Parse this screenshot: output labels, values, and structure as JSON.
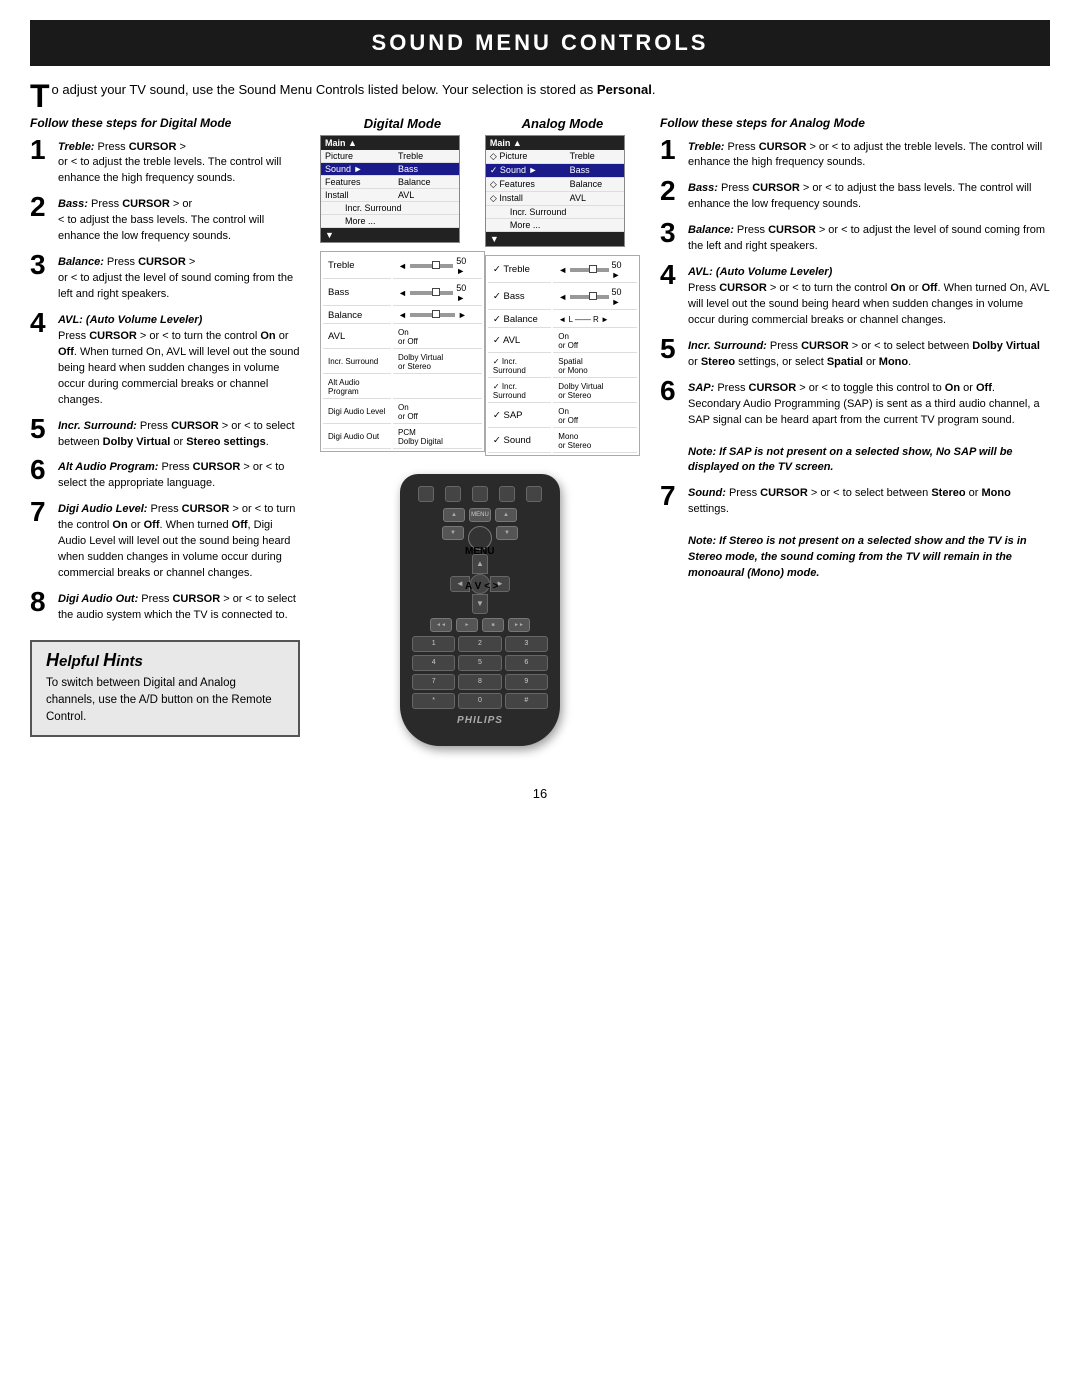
{
  "title": "SOUND MENU CONTROLS",
  "intro": {
    "drop_cap": "T",
    "text": "o adjust your TV sound, use the Sound Menu Controls listed below.  Your selection is stored as ",
    "bold": "Personal",
    "end": "."
  },
  "left": {
    "section_header": "Follow these steps for Digital Mode",
    "steps": [
      {
        "num": "1",
        "label_bold": "Treble:",
        "label_rest": " Press ",
        "cursor": "CURSOR",
        "after_cursor": " >",
        "body": "or < to adjust the treble levels. The control will enhance the high frequency sounds."
      },
      {
        "num": "2",
        "label_bold": "Bass:",
        "label_rest": " Press ",
        "cursor": "CURSOR",
        "after_cursor": " > or",
        "body": "< to adjust the bass levels. The control will enhance the low frequency sounds."
      },
      {
        "num": "3",
        "label_bold": "Balance:",
        "label_rest": " Press ",
        "cursor": "CURSOR",
        "after_cursor": " >",
        "body": "or < to adjust the level of sound coming from the left and right speakers."
      },
      {
        "num": "4",
        "label_bold": "AVL:  (Auto Volume Leveler)",
        "body_before": "Press ",
        "cursor": "CURSOR",
        "after_cursor": " > or <",
        "body": "to turn the control On or Off. When turned On, AVL will level out the sound being heard when sudden changes in volume occur during commercial breaks or channel changes."
      },
      {
        "num": "5",
        "label_bold": "Incr. Surround:",
        "label_rest": " Press",
        "cursor": "CURSOR",
        "after_cursor": " > or <",
        "body": "to select between Dolby Virtual or Stereo settings."
      },
      {
        "num": "6",
        "label_bold": "Alt Audio Program:",
        "label_rest": " Press",
        "cursor": "CURSOR",
        "after_cursor": " > or <",
        "body": "to select the appropriate language."
      },
      {
        "num": "7",
        "label_bold": "Digi Audio Level:",
        "label_rest": " Press",
        "cursor": "CURSOR",
        "after_cursor": " > or <",
        "body": "to turn the control On or Off. When turned Off, Digi Audio Level will level out the sound being heard when sudden changes in volume occur during commercial breaks or channel changes."
      },
      {
        "num": "8",
        "label_bold": "Digi Audio Out:",
        "label_rest": " Press",
        "cursor": "CURSOR",
        "after_cursor": " > or <",
        "body": "to select the audio system which the TV is connected to."
      }
    ]
  },
  "right": {
    "section_header": "Follow these steps for Analog Mode",
    "steps": [
      {
        "num": "1",
        "label_bold": "Treble:",
        "label_rest": " Press ",
        "cursor": "CURSOR",
        "after_cursor": " > or",
        "body": "< to adjust the treble levels. The control will enhance the high frequency sounds."
      },
      {
        "num": "2",
        "label_bold": "Bass:",
        "label_rest": " Press ",
        "cursor": "CURSOR",
        "after_cursor": " > or <",
        "body": "to adjust the bass levels. The control will enhance the low frequency sounds."
      },
      {
        "num": "3",
        "label_bold": "Balance:",
        "label_rest": " Press ",
        "cursor": "CURSOR",
        "after_cursor": " >",
        "body": "or < to adjust the level of sound coming from the left and right speakers."
      },
      {
        "num": "4",
        "label_bold": "AVL:  (Auto Volume Leveler)",
        "body_before": "Press ",
        "cursor": "CURSOR",
        "after_cursor": " >",
        "body": "or < to turn the control On or Off. When turned On, AVL will level out the sound being heard when sudden changes in volume occur during commercial breaks or channel changes."
      },
      {
        "num": "5",
        "label_bold": "Incr. Surround:",
        "label_rest": " Press",
        "cursor": "CURSOR",
        "after_cursor": " > or <",
        "body": "to select between Dolby Virtual or Stereo settings, or select Spatial or Mono."
      },
      {
        "num": "6",
        "label_bold": "SAP:",
        "label_rest": " Press ",
        "cursor": "CURSOR",
        "after_cursor": " >",
        "body": "or < to toggle this control to On or Off. Secondary Audio Programming (SAP) is sent as a third audio channel, a SAP signal can be heard apart from the current TV program sound.",
        "note": "Note:  If SAP is not present on a selected show,  No SAP will be displayed on the TV screen."
      },
      {
        "num": "7",
        "label_bold": "Sound:",
        "label_rest": " Press ",
        "cursor": "CURSOR",
        "after_cursor": " > or",
        "body": "< to select between Stereo or Mono settings.",
        "note": "Note:  If Stereo is not present on a selected show and the TV is in Stereo mode, the sound coming from the TV will remain in the monoaural (Mono) mode."
      }
    ]
  },
  "center": {
    "digital_mode_label": "Digital Mode",
    "analog_mode_label": "Analog Mode",
    "menu_label": "MENU",
    "cursor_label": "A V < >"
  },
  "helpful_hints": {
    "title": "Helpful Hints",
    "body": "To switch between Digital and Analog channels, use the A/D button on the Remote Control."
  },
  "page_number": "16",
  "digital_menu": {
    "header": "Main",
    "rows": [
      {
        "label": "Picture",
        "value": "Treble",
        "selected": false
      },
      {
        "label": "Sound",
        "value": "Bass",
        "selected": true
      },
      {
        "label": "Features",
        "value": "Balance",
        "selected": false
      },
      {
        "label": "Install",
        "value": "AVL",
        "selected": false
      },
      {
        "label": "",
        "value": "Incr. Surround",
        "selected": false
      },
      {
        "label": "",
        "value": "More ...",
        "selected": false
      }
    ]
  },
  "analog_menu": {
    "header": "Main",
    "rows": [
      {
        "label": "◇ Picture",
        "value": "Treble",
        "selected": false
      },
      {
        "label": "✓ Sound",
        "value": "Bass",
        "selected": true
      },
      {
        "label": "◇ Features",
        "value": "Balance",
        "selected": false
      },
      {
        "label": "◇ Install",
        "value": "AVL",
        "selected": false
      },
      {
        "label": "",
        "value": "Incr. Surround",
        "selected": false
      },
      {
        "label": "",
        "value": "More ...",
        "selected": false
      }
    ]
  },
  "sliders_digital": [
    {
      "label": "Treble",
      "arrow_l": "◄",
      "value": "50",
      "arrow_r": "►"
    },
    {
      "label": "Bass",
      "arrow_l": "◄",
      "value": "50",
      "arrow_r": "►"
    },
    {
      "label": "Balance",
      "arrow_l": "◄",
      "value": "",
      "arrow_r": "►"
    },
    {
      "label": "AVL",
      "value": "On\nor Off",
      "no_slider": true
    },
    {
      "label": "Incr. Surround",
      "value": "Dolby Virtual\nor Stereo",
      "no_slider": true
    },
    {
      "label": "Alt Audio Program",
      "value": "",
      "no_slider": true
    },
    {
      "label": "Digi Audio Level",
      "value": "On\nor Off",
      "no_slider": true
    },
    {
      "label": "Digi Audio Out",
      "value": "PCM\nDolby Digital",
      "no_slider": true
    }
  ],
  "sliders_analog": [
    {
      "label": "✓ Treble",
      "arrow_l": "◄",
      "value": "50",
      "arrow_r": "►"
    },
    {
      "label": "✓ Bass",
      "arrow_l": "◄",
      "value": "50",
      "arrow_r": "►"
    },
    {
      "label": "✓ Balance",
      "arrow_l": "◄",
      "value": "L◄—►R",
      "special": true
    },
    {
      "label": "✓ AVL",
      "value": "On\nor Off",
      "no_slider": true
    },
    {
      "label": "✓ Incr. Surround",
      "value": "Spatial\nor Mono",
      "no_slider": true
    },
    {
      "label": "✓ Incr. Surround",
      "value": "Dolby Virtual\nor Stereo",
      "no_slider": true
    },
    {
      "label": "✓ SAP",
      "value": "On\nor Off",
      "no_slider": true
    },
    {
      "label": "✓ Sound",
      "value": "Mono\nor Stereo",
      "no_slider": true
    }
  ]
}
